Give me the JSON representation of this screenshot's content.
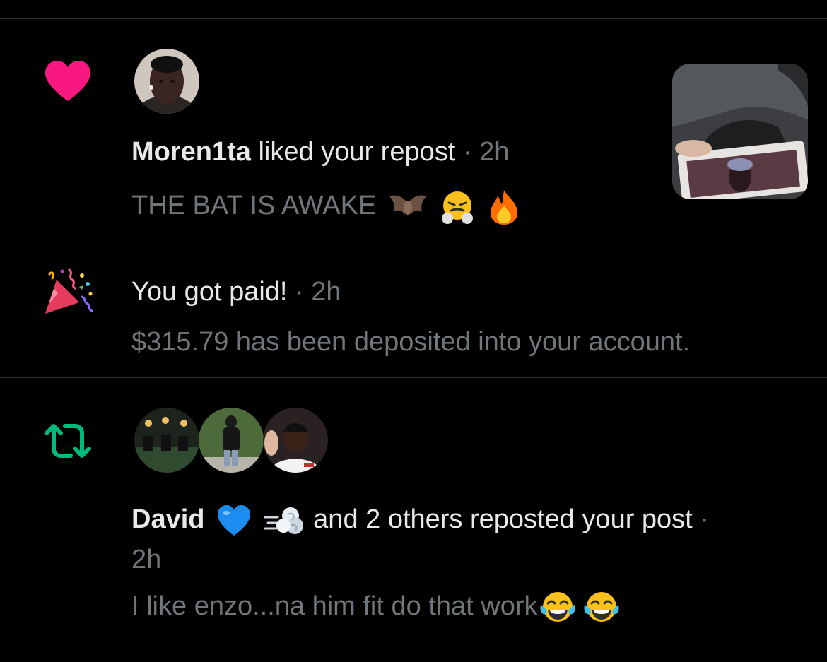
{
  "notifications": [
    {
      "type": "like",
      "icon": "heart-icon",
      "accent": "#f91880",
      "actor": "Moren1ta",
      "action": "liked your repost",
      "separator": "·",
      "time": "2h",
      "content": "THE BAT IS AWAKE",
      "content_emojis": [
        "bat-emoji",
        "steam-nose-face-emoji",
        "fire-emoji"
      ]
    },
    {
      "type": "payment",
      "icon": "party-popper-icon",
      "title": "You got paid!",
      "separator": "·",
      "time": "2h",
      "content": "$315.79 has been deposited into your account."
    },
    {
      "type": "repost",
      "icon": "repost-icon",
      "accent": "#00ba7c",
      "actor": "David",
      "actor_emojis": [
        "blue-heart-emoji",
        "dash-emoji"
      ],
      "action": "and 2 others reposted your post",
      "separator": "·",
      "time": "2h",
      "content": "I like enzo...na him fit do that work",
      "content_emojis": [
        "tears-of-joy-emoji",
        "tears-of-joy-emoji"
      ]
    }
  ]
}
